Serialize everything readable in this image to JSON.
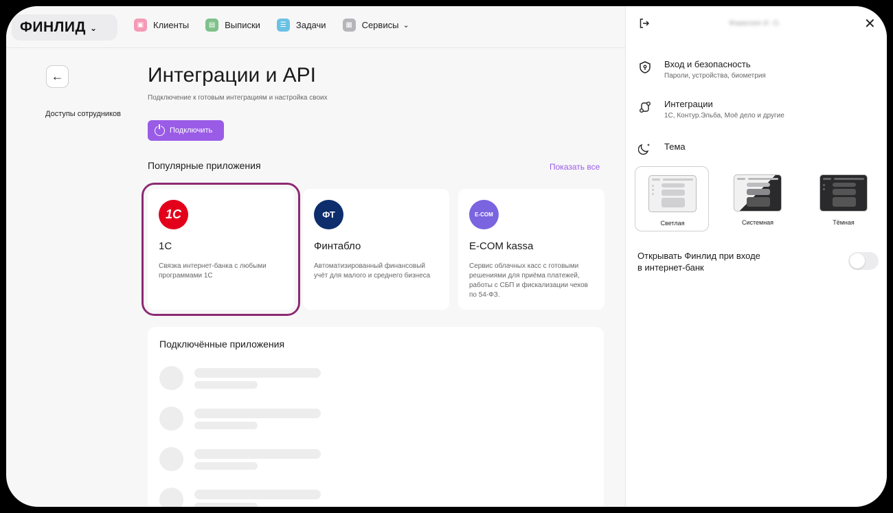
{
  "brand": {
    "logo_text": "ФИНЛИД"
  },
  "nav": [
    {
      "label": "Клиенты",
      "icon": "briefcase-icon",
      "color": "#f59ab6"
    },
    {
      "label": "Выписки",
      "icon": "document-icon",
      "color": "#7ec18a"
    },
    {
      "label": "Задачи",
      "icon": "tasks-icon",
      "color": "#6bc1e4"
    },
    {
      "label": "Сервисы",
      "icon": "grid-icon",
      "color": "#b5b5ba",
      "has_dropdown": true
    }
  ],
  "sidebar": {
    "link": "Доступы сотрудников"
  },
  "main": {
    "title": "Интеграции и API",
    "subtitle": "Подключение к готовым интеграциям и настройка своих",
    "connect_button": "Подключить",
    "popular_title": "Популярные приложения",
    "show_all": "Показать все",
    "apps": [
      {
        "icon_text": "1С",
        "name": "1С",
        "desc": "Связка интернет-банка с любыми программами 1С",
        "color": "#e3001b",
        "selected": true
      },
      {
        "icon_text": "ФТ",
        "name": "Финтабло",
        "desc": "Автоматизированный финансовый учёт для малого и среднего бизнеса",
        "color": "#0d2d6c",
        "selected": false
      },
      {
        "icon_text": "E-COM",
        "name": "E-COM kassa",
        "desc": "Сервис облачных касс с готовыми решениями для приёма платежей, работы с СБП и фискализации чеков по 54-ФЗ.",
        "color": "#7b64e0",
        "selected": false
      }
    ],
    "connected_title": "Подключённые приложения"
  },
  "panel": {
    "user_name": "Фамилия И. О.",
    "security": {
      "title": "Вход и безопасность",
      "sub": "Пароли, устройства, биометрия"
    },
    "integrations": {
      "title": "Интеграции",
      "sub": "1С, Контур.Эльба, Моё дело и другие"
    },
    "theme": {
      "title": "Тема",
      "options": [
        {
          "label": "Светлая",
          "selected": true
        },
        {
          "label": "Системная",
          "selected": false
        },
        {
          "label": "Тёмная",
          "selected": false
        }
      ]
    },
    "toggle": {
      "label_line1": "Открывать Финлид при входе",
      "label_line2": "в интернет-банк",
      "on": false
    }
  },
  "colors": {
    "accent": "#9a5ce6",
    "highlight": "#8c2a72"
  }
}
